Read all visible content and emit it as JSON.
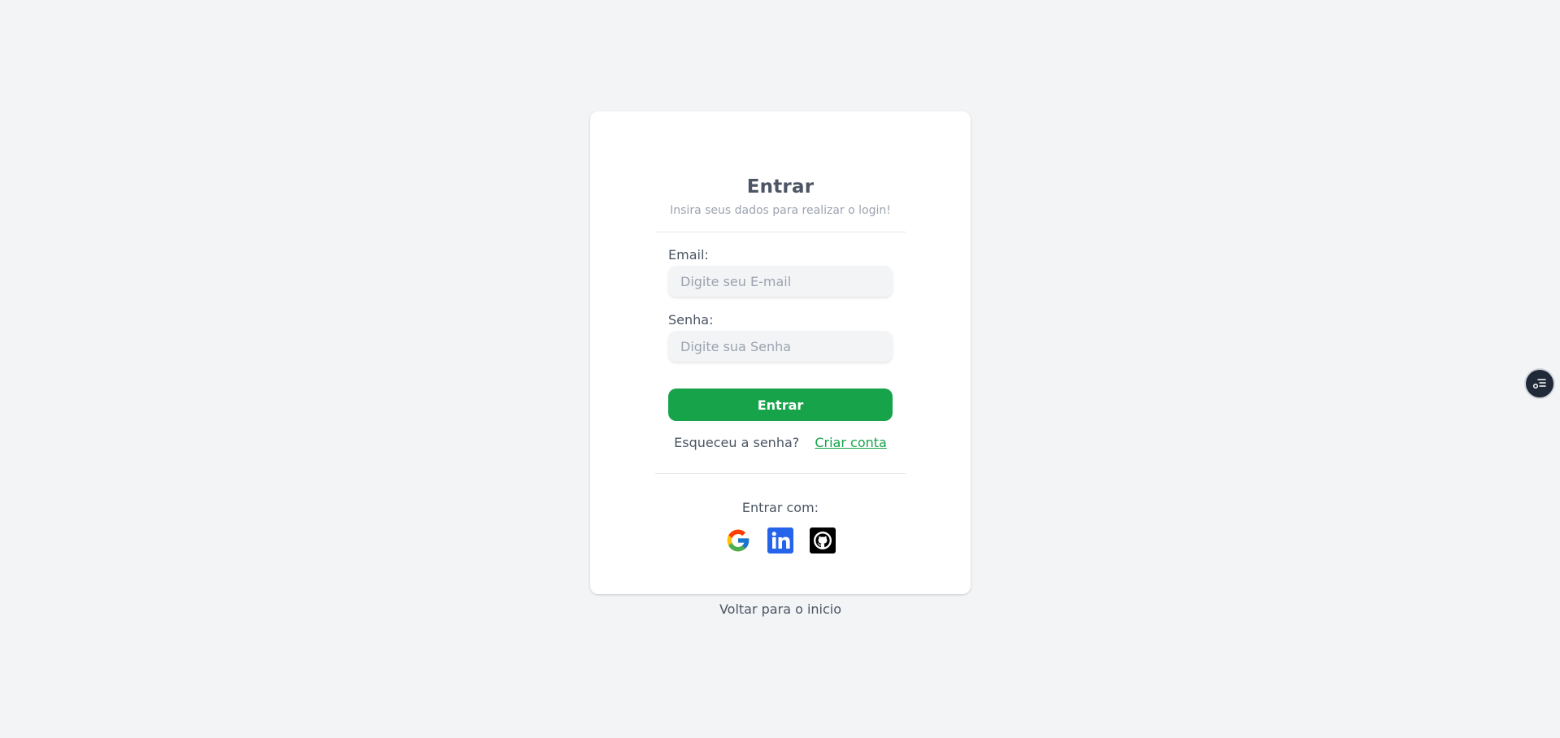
{
  "login": {
    "title": "Entrar",
    "subtitle": "Insira seus dados para realizar o login!",
    "email_label": "Email:",
    "email_placeholder": "Digite seu E-mail",
    "email_value": "",
    "password_label": "Senha:",
    "password_placeholder": "Digite sua Senha",
    "password_value": "",
    "submit_label": "Entrar",
    "forgot_label": "Esqueceu a senha?",
    "create_label": "Criar conta",
    "social_label": "Entrar com:",
    "social": [
      {
        "icon": "google-icon"
      },
      {
        "icon": "linkedin-icon"
      },
      {
        "icon": "github-icon"
      }
    ]
  },
  "footer": {
    "back_label": "Voltar para o inicio"
  },
  "floating": {
    "icon": "list-settings-icon"
  },
  "colors": {
    "background": "#f3f4f6",
    "card": "#ffffff",
    "accent": "#16a34a",
    "linkedin": "#2563eb",
    "github": "#000000"
  }
}
